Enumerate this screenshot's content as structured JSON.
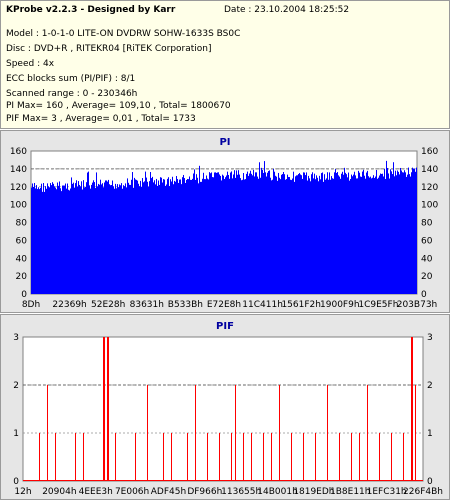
{
  "header": {
    "title": "KProbe v2.2.3 - Designed by Karr",
    "date": "Date : 23.10.2004 18:25:52",
    "lines": [
      "Model : 1-0-1-0 LITE-ON DVDRW SOHW-1633S BS0C",
      "Disc : DVD+R , RITEKR04 [RiTEK Corporation]",
      "Speed : 4x",
      "ECC blocks sum (PI/PIF) : 8/1",
      "Scanned range : 0 - 230346h",
      "PI Max= 160 , Average= 109,10 , Total= 1800670",
      "PIF Max= 3 , Average= 0,01 , Total= 1733"
    ]
  },
  "colors": {
    "pi_fill": "#0000ff",
    "pif_fill": "#ff0000",
    "plot_bg": "#ffffff",
    "panel_bg": "#e6e6e6",
    "grid": "#909090",
    "title_text": "#0000a0"
  },
  "chart_data": [
    {
      "type": "bar",
      "title": "PI",
      "xlabel": "",
      "ylabel": "",
      "ylim": [
        0,
        160
      ],
      "yticks": [
        "0",
        "20",
        "40",
        "60",
        "80",
        "100",
        "120",
        "140",
        "160"
      ],
      "xticks": [
        "8Dh",
        "22369h",
        "52E28h",
        "83631h",
        "B533Bh",
        "E72E8h",
        "11C411h",
        "1561F2h",
        "1900F9h",
        "1C9E5Fh",
        "203B73h"
      ],
      "reference_line": 140,
      "grid": true,
      "series": [
        {
          "values": [
            [
              0,
              125
            ],
            [
              0.05,
              126
            ],
            [
              0.1,
              127
            ],
            [
              0.15,
              128
            ],
            [
              0.2,
              128
            ],
            [
              0.25,
              130
            ],
            [
              0.3,
              131
            ],
            [
              0.35,
              132
            ],
            [
              0.4,
              134
            ],
            [
              0.45,
              136
            ],
            [
              0.5,
              138
            ],
            [
              0.55,
              139
            ],
            [
              0.6,
              139
            ],
            [
              0.65,
              138
            ],
            [
              0.7,
              137
            ],
            [
              0.75,
              137
            ],
            [
              0.8,
              138
            ],
            [
              0.85,
              139
            ],
            [
              0.9,
              140
            ],
            [
              0.95,
              141
            ],
            [
              1,
              143
            ]
          ],
          "spread": 12,
          "max": 160
        }
      ]
    },
    {
      "type": "bar",
      "title": "PIF",
      "xlabel": "",
      "ylabel": "",
      "ylim": [
        0,
        3
      ],
      "yticks": [
        "0",
        "1",
        "2",
        "3"
      ],
      "xticks": [
        "12h",
        "20904h",
        "4EEE3h",
        "7E006h",
        "ADF45h",
        "DF966h",
        "113655h",
        "14B001h",
        "1819EDh",
        "1B8E11h",
        "1EFC31h",
        "226F4Bh"
      ],
      "reference_line": 2,
      "grid": true,
      "series": [
        {
          "values": [
            [
              0.04,
              1
            ],
            [
              0.06,
              2
            ],
            [
              0.08,
              1
            ],
            [
              0.13,
              1
            ],
            [
              0.15,
              1
            ],
            [
              0.2,
              3
            ],
            [
              0.21,
              3
            ],
            [
              0.23,
              1
            ],
            [
              0.28,
              1
            ],
            [
              0.31,
              2
            ],
            [
              0.35,
              1
            ],
            [
              0.37,
              1
            ],
            [
              0.41,
              1
            ],
            [
              0.43,
              2
            ],
            [
              0.46,
              1
            ],
            [
              0.49,
              1
            ],
            [
              0.52,
              1
            ],
            [
              0.53,
              2
            ],
            [
              0.55,
              1
            ],
            [
              0.57,
              1
            ],
            [
              0.6,
              1
            ],
            [
              0.62,
              1
            ],
            [
              0.64,
              2
            ],
            [
              0.67,
              1
            ],
            [
              0.7,
              1
            ],
            [
              0.73,
              1
            ],
            [
              0.76,
              2
            ],
            [
              0.79,
              1
            ],
            [
              0.82,
              1
            ],
            [
              0.84,
              1
            ],
            [
              0.86,
              2
            ],
            [
              0.89,
              1
            ],
            [
              0.92,
              1
            ],
            [
              0.95,
              1
            ],
            [
              0.97,
              3
            ],
            [
              0.98,
              2
            ]
          ]
        }
      ]
    }
  ]
}
